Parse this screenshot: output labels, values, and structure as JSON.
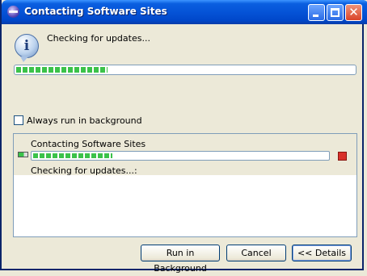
{
  "window": {
    "title": "Contacting Software Sites",
    "controls": {
      "close": "✕"
    }
  },
  "icon": {
    "info": "i"
  },
  "message": "Checking for updates...",
  "main_progress": {
    "fraction": 0.27
  },
  "background_option": {
    "label": "Always run in background",
    "checked": false
  },
  "details": {
    "job_title": "Contacting Software Sites",
    "job_progress": {
      "fraction": 0.27
    },
    "job_status": "Checking for updates...:"
  },
  "buttons": {
    "run_in_background": "Run in Background",
    "cancel": "Cancel",
    "details": "<< Details"
  },
  "colors": {
    "progress_green": "#3bc24a",
    "titlebar_blue": "#0553d7",
    "stop_red": "#d8312a"
  }
}
